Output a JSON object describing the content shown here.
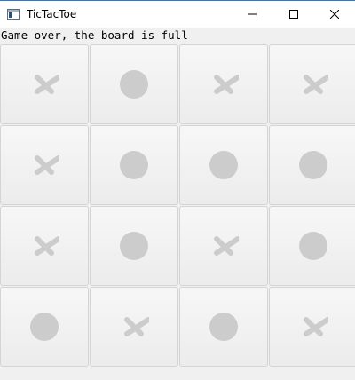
{
  "window": {
    "title": "TicTacToe"
  },
  "status_text": "Game over, the board is full",
  "board": {
    "cells": [
      "X",
      "O",
      "X",
      "X",
      "X",
      "O",
      "O",
      "O",
      "X",
      "O",
      "X",
      "O",
      "O",
      "X",
      "O",
      "X"
    ]
  },
  "colors": {
    "mark": "#cccccc",
    "cell_background": "#efefef",
    "window_background": "#f0f0f0"
  },
  "icons": {
    "x_mark": "x-mark-icon",
    "o_mark": "o-mark-icon"
  }
}
